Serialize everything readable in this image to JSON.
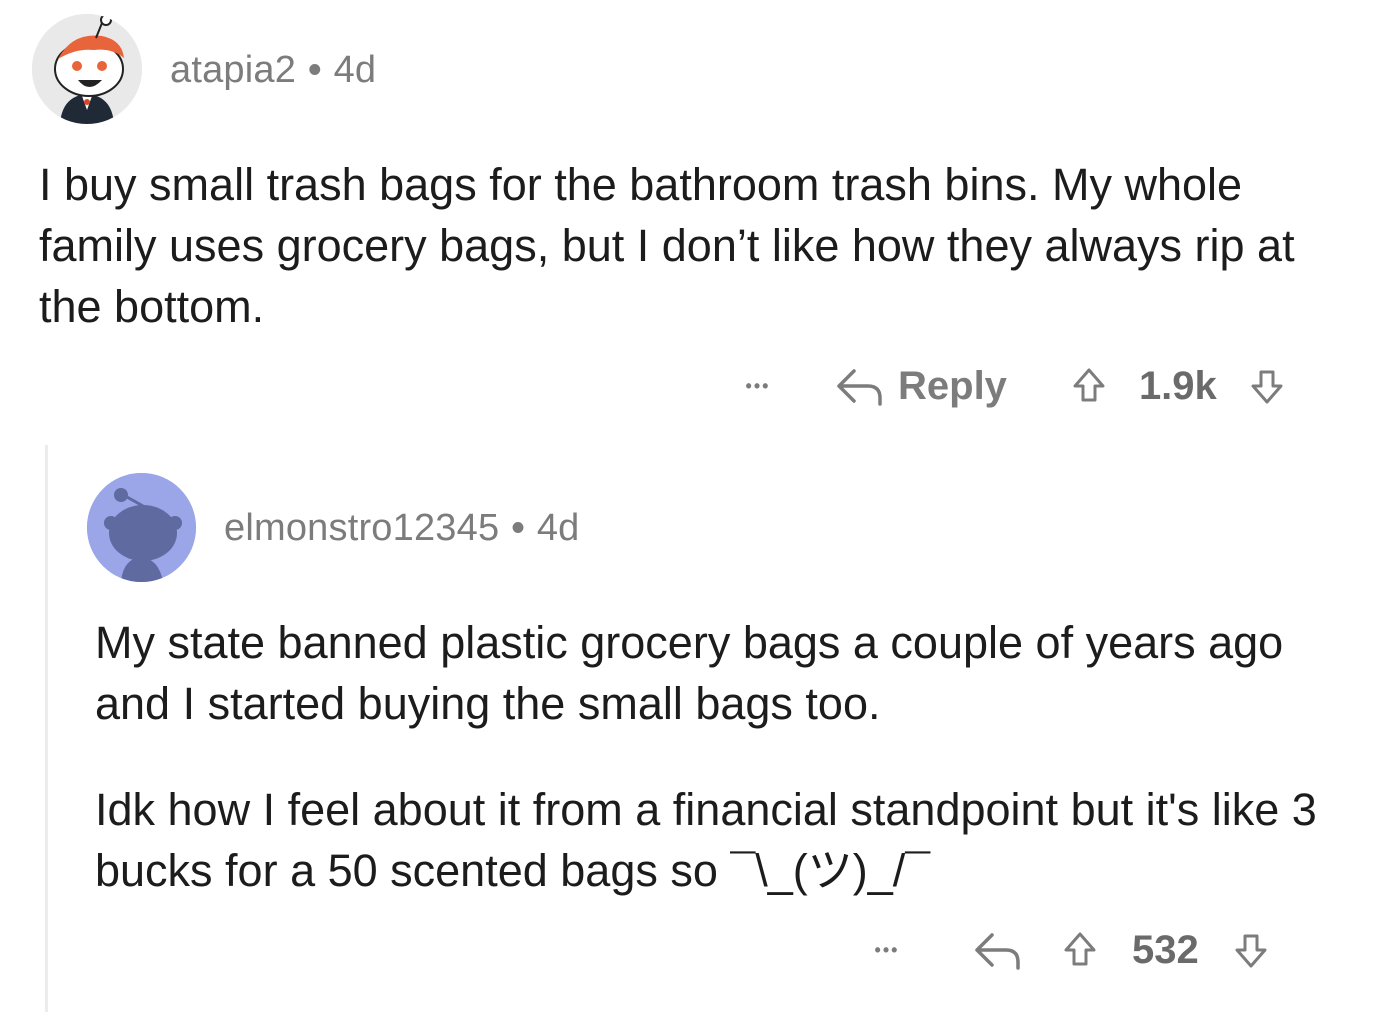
{
  "comments": [
    {
      "username": "atapia2",
      "separator": "•",
      "age": "4d",
      "paragraphs": [
        "I buy small trash bags for the bathroom trash bins. My whole family uses grocery bags, but I don’t like how they always rip at the bottom."
      ],
      "more_label": "•••",
      "reply_label": "Reply",
      "score": "1.9k"
    },
    {
      "username": "elmonstro12345",
      "separator": "•",
      "age": "4d",
      "paragraphs": [
        "My state banned plastic grocery bags a couple of years ago and I started buying the small bags too.",
        "Idk how I feel about it from a financial standpoint but it's like 3 bucks for a 50 scented bags so ¯\\_(ツ)_/¯"
      ],
      "more_label": "•••",
      "score": "532"
    }
  ],
  "colors": {
    "meta_text": "#7c7c7c",
    "body_text": "#1c1c1c",
    "avatar1_bg": "#e9e9e9",
    "avatar2_bg": "#9aa6e8",
    "thread_line": "#ececec"
  },
  "icons": {
    "reply": "reply-arrow-icon",
    "upvote": "upvote-arrow-icon",
    "downvote": "downvote-arrow-icon",
    "more": "more-options-icon"
  }
}
